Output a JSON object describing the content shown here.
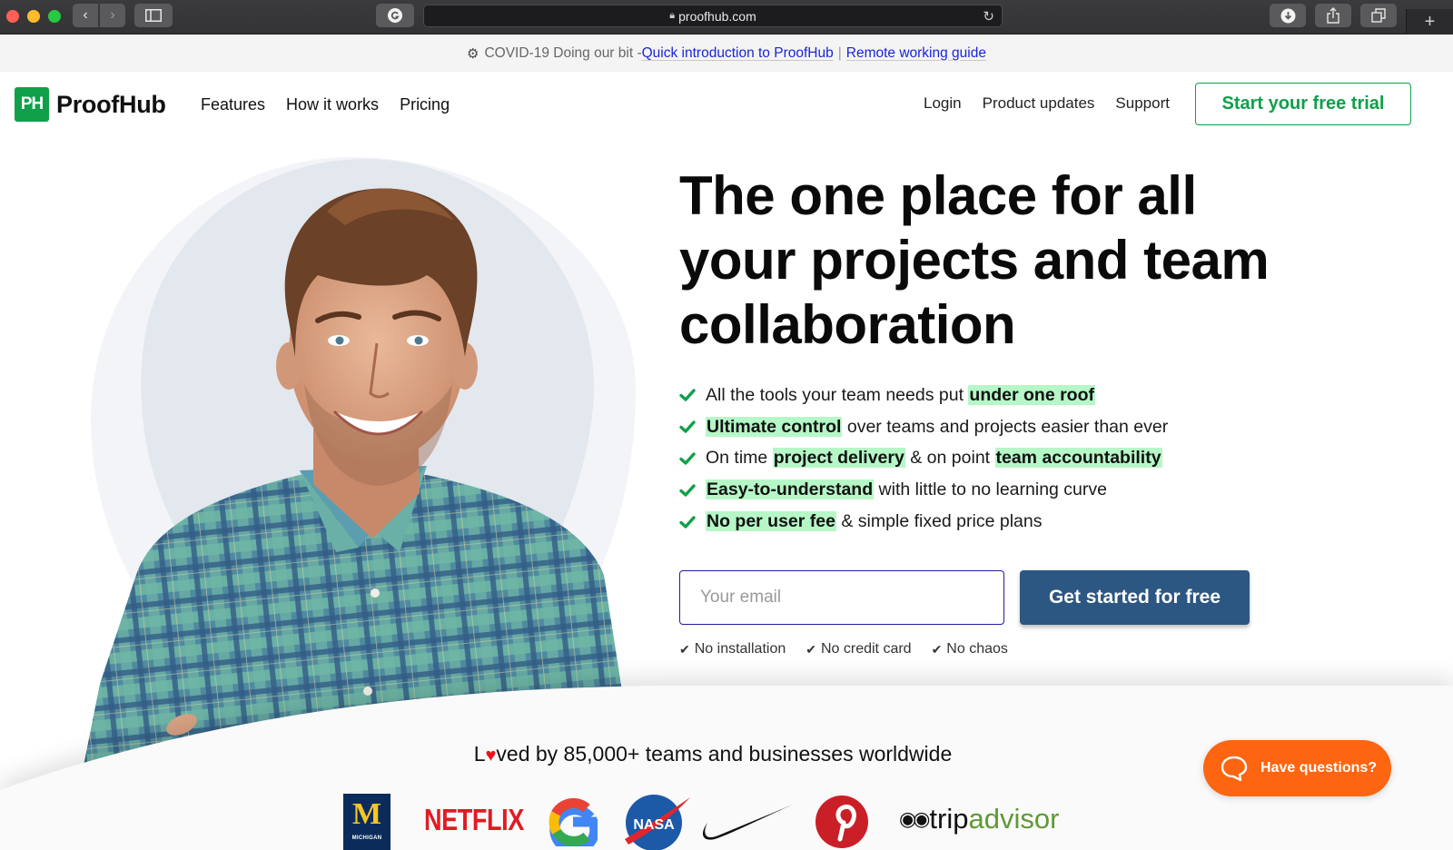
{
  "browser": {
    "url": "proofhub.com",
    "icons": {
      "back": "chevron-left-icon",
      "forward": "chevron-right-icon",
      "sidebar": "sidebar-icon",
      "grammarly": "grammarly-icon",
      "lock": "lock-icon",
      "reload": "reload-icon",
      "download": "download-icon",
      "share": "share-icon",
      "tabs": "tabs-icon",
      "new_tab": "plus-icon"
    }
  },
  "banner": {
    "prefix": "COVID-19 Doing our bit - ",
    "link1": "Quick introduction to ProofHub",
    "separator": "|",
    "link2": "Remote working guide"
  },
  "nav": {
    "logo_mark": "PH",
    "logo_text": "ProofHub",
    "left_links": [
      "Features",
      "How it works",
      "Pricing"
    ],
    "right_links": [
      "Login",
      "Product updates",
      "Support"
    ],
    "trial_button": "Start your free trial"
  },
  "hero": {
    "headline_lines": [
      "The one place for all",
      "your projects and team",
      "collaboration"
    ],
    "features": [
      [
        {
          "t": "All the tools your team needs put ",
          "h": false
        },
        {
          "t": "under one roof",
          "h": true
        }
      ],
      [
        {
          "t": "Ultimate control",
          "h": true
        },
        {
          "t": " over teams and projects easier than ever",
          "h": false
        }
      ],
      [
        {
          "t": "On time ",
          "h": false
        },
        {
          "t": "project delivery",
          "h": true
        },
        {
          "t": " & on point ",
          "h": false
        },
        {
          "t": "team accountability",
          "h": true
        }
      ],
      [
        {
          "t": "Easy-to-understand",
          "h": true
        },
        {
          "t": " with little to no learning curve",
          "h": false
        }
      ],
      [
        {
          "t": "No per user fee",
          "h": true
        },
        {
          "t": " & simple fixed price plans",
          "h": false
        }
      ]
    ],
    "email_placeholder": "Your email",
    "email_value": "",
    "cta_button": "Get started for free",
    "perks": [
      "No installation",
      "No credit card",
      "No chaos"
    ]
  },
  "social_proof": {
    "loved_prefix": "L",
    "loved_suffix": "ved by 85,000+ teams and businesses worldwide",
    "logos": [
      "University of Michigan",
      "Netflix",
      "Google",
      "NASA",
      "Nike",
      "Pinterest",
      "tripadvisor"
    ],
    "michigan_letter": "M",
    "michigan_label": "MICHIGAN",
    "netflix_text": "NETFLIX",
    "nasa_text": "NASA",
    "trip_prefix": "trip",
    "trip_suffix": "advisor"
  },
  "chat": {
    "label": "Have questions?"
  },
  "colors": {
    "brand_green": "#10a049",
    "highlight": "#b6f7c7",
    "cta_blue": "#2b5782",
    "chat_orange": "#fd6510",
    "link_blue": "#1a25d8"
  }
}
